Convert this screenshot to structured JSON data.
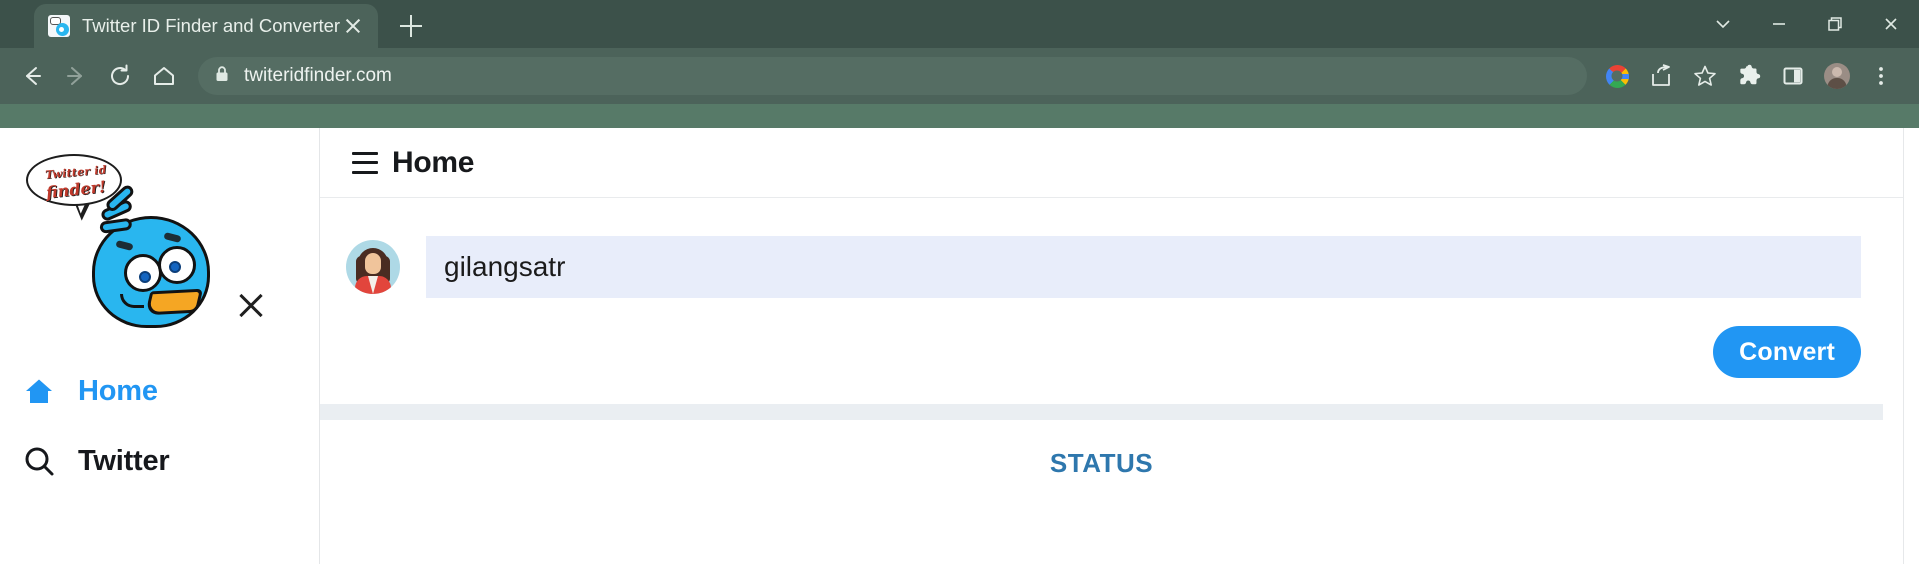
{
  "browser": {
    "tab": {
      "title": "Twitter ID Finder and Converter",
      "favicon_name": "twitter-id-finder-favicon",
      "close_label": "×"
    },
    "new_tab_label": "+",
    "window_controls": [
      {
        "name": "tab-search-button",
        "label": "⌄"
      },
      {
        "name": "minimize-button",
        "label": "—"
      },
      {
        "name": "maximize-button",
        "label": "❐"
      },
      {
        "name": "close-window-button",
        "label": "✕"
      }
    ],
    "nav": {
      "back_label": "←",
      "forward_label": "→",
      "reload_label": "⟳",
      "home_label": "⌂"
    },
    "omnibox": {
      "url": "twiteridfinder.com",
      "lock_label": "🔒"
    },
    "toolbar_icons": [
      {
        "name": "google-lens-icon",
        "label": "G"
      },
      {
        "name": "share-icon",
        "label": "↗"
      },
      {
        "name": "bookmark-star-icon",
        "label": "☆"
      },
      {
        "name": "extensions-puzzle-icon",
        "label": "🧩"
      },
      {
        "name": "side-panel-icon",
        "label": "▯"
      },
      {
        "name": "profile-avatar-icon",
        "label": ""
      },
      {
        "name": "chrome-menu-icon",
        "label": "⋮"
      }
    ],
    "colors": {
      "tabstrip": "#3c514a",
      "toolbar": "#4c635a",
      "band": "#577a68",
      "omnibox": "#556d63"
    }
  },
  "sidebar": {
    "logo": {
      "bubble_line1": "Twitter id",
      "bubble_line2": "finder!",
      "alt": "twitter-id-finder-bird-logo"
    },
    "close_label": "✕",
    "items": [
      {
        "label": "Home",
        "icon": "home-icon",
        "active": true
      },
      {
        "label": "Twitter",
        "icon": "search-icon",
        "active": false
      }
    ]
  },
  "main": {
    "header": {
      "title": "Home",
      "menu_icon": "hamburger-menu-icon"
    },
    "form": {
      "avatar_name": "user-avatar",
      "username_value": "gilangsatr",
      "username_placeholder": "",
      "convert_label": "Convert"
    },
    "status_label": "STATUS"
  },
  "colors": {
    "accent_blue": "#2196f3",
    "input_bg": "#e8edfa",
    "status_blue": "#2e77ad",
    "divider": "#eaeef2"
  }
}
